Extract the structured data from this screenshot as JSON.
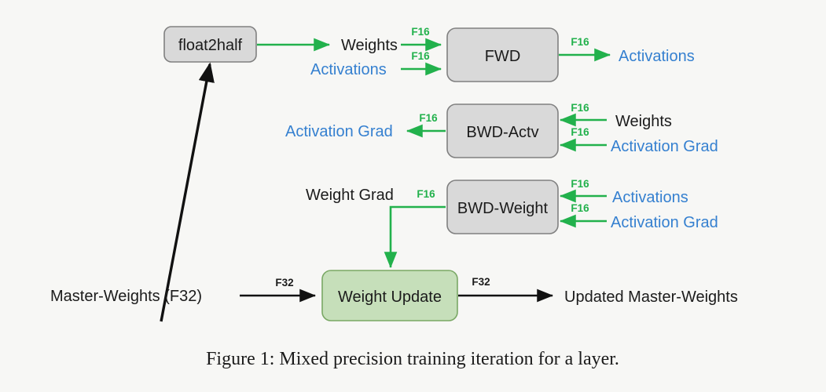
{
  "figure": {
    "caption": "Figure 1:  Mixed precision training iteration for a layer.",
    "background_color": "#f7f7f5"
  },
  "colors": {
    "block_gray_fill": "#d9d9d9",
    "block_gray_stroke": "#808080",
    "block_green_fill": "#c6dfba",
    "block_green_stroke": "#7aa865",
    "arrow_green": "#22b14c",
    "arrow_black": "#111111",
    "text_black": "#1b1b1b",
    "text_blue": "#3580d0"
  },
  "nodes": {
    "float2half": "float2half",
    "fwd": "FWD",
    "bwd_actv": "BWD-Actv",
    "bwd_weight": "BWD-Weight",
    "weight_update": "Weight Update"
  },
  "tensors": {
    "weights_fwd": "Weights",
    "activations_fwd_in": "Activations",
    "activations_fwd_out": "Activations",
    "activation_grad_out": "Activation Grad",
    "weights_bwd_actv": "Weights",
    "activation_grad_bwd_actv": "Activation Grad",
    "weight_grad": "Weight Grad",
    "activations_bwd_weight": "Activations",
    "activation_grad_bwd_weight": "Activation Grad",
    "master_weights": "Master-Weights (F32)",
    "updated_master_weights": "Updated Master-Weights"
  },
  "edge_labels": {
    "f16_weights_to_fwd": "F16",
    "f16_activations_to_fwd": "F16",
    "f16_fwd_to_activations": "F16",
    "f16_bwd_actv_to_grad": "F16",
    "f16_weights_to_bwd_actv": "F16",
    "f16_grad_to_bwd_actv": "F16",
    "f16_bwd_weight_to_weight_grad": "F16",
    "f16_activations_to_bwd_weight": "F16",
    "f16_grad_to_bwd_weight": "F16",
    "f32_master_to_update": "F32",
    "f32_update_to_updated": "F32"
  }
}
